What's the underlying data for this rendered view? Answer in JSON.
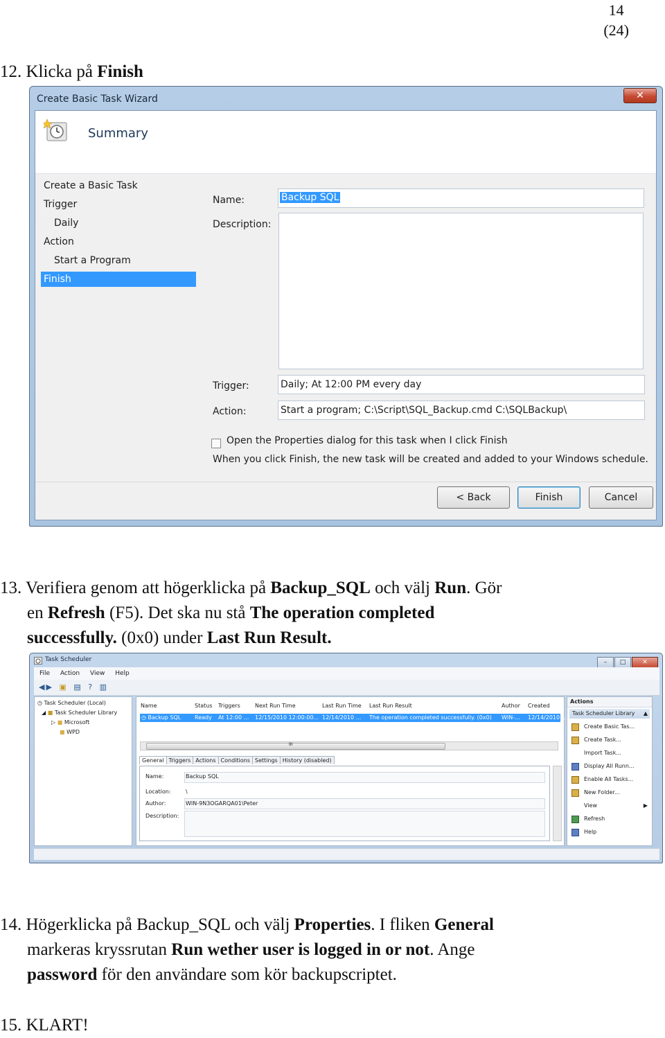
{
  "page": {
    "number": "14",
    "total": "(24)"
  },
  "step12": {
    "text": "12. Klicka på ",
    "bold": "Finish"
  },
  "wizard": {
    "title": "Create Basic Task Wizard",
    "close": "✕",
    "summary": "Summary",
    "nav": [
      "Create a Basic Task",
      "Trigger",
      "Daily",
      "Action",
      "Start a Program",
      "Finish"
    ],
    "name_label": "Name:",
    "name_value": "Backup SQL",
    "description_label": "Description:",
    "trigger_label": "Trigger:",
    "trigger_value": "Daily; At 12:00 PM every day",
    "action_label": "Action:",
    "action_value": "Start a program; C:\\Script\\SQL_Backup.cmd C:\\SQLBackup\\",
    "checkbox_label": "Open the Properties dialog for this task when I click Finish",
    "note": "When you click Finish, the new task will be created and added to your Windows schedule.",
    "back_button": "< Back",
    "finish_button": "Finish",
    "cancel_button": "Cancel"
  },
  "step13": {
    "t1": "13. Verifiera genom att högerklicka på ",
    "b1": "Backup_SQL",
    "t2": " och välj ",
    "b2": "Run",
    "t3": ". Gör",
    "t4": "en ",
    "b3": "Refresh",
    "t5": " (F5). Det ska nu stå ",
    "b4": "The operation completed",
    "b5": "successfully.",
    "t6": " (0x0) under ",
    "b6": "Last Run Result."
  },
  "scheduler": {
    "title": "Task Scheduler",
    "menu": [
      "File",
      "Action",
      "View",
      "Help"
    ],
    "tree": [
      "Task Scheduler (Local)",
      "Task Scheduler Library",
      "Microsoft",
      "WPD"
    ],
    "columns": [
      "Name",
      "Status",
      "Triggers",
      "Next Run Time",
      "Last Run Time",
      "Last Run Result",
      "Author",
      "Created"
    ],
    "row": [
      "Backup SQL",
      "Ready",
      "At 12:00 ...",
      "12/15/2010 12:00:00...",
      "12/14/2010 ...",
      "The operation completed successfully. (0x0)",
      "WIN-...",
      "12/14/2010 ..."
    ],
    "scroll_marker": "III",
    "tabs": [
      "General",
      "Triggers",
      "Actions",
      "Conditions",
      "Settings",
      "History (disabled)"
    ],
    "general": {
      "name_label": "Name:",
      "name_value": "Backup SQL",
      "location_label": "Location:",
      "location_value": "\\",
      "author_label": "Author:",
      "author_value": "WIN-9N3OGARQA01\\Peter",
      "description_label": "Description:"
    },
    "actions_header": "Actions",
    "actions_sub": "Task Scheduler Library",
    "actions": [
      "Create Basic Tas...",
      "Create Task...",
      "Import Task...",
      "Display All Runn...",
      "Enable All Tasks...",
      "New Folder...",
      "View",
      "Refresh",
      "Help"
    ]
  },
  "step14": {
    "t1": "14. Högerklicka på Backup_SQL och välj ",
    "b1": "Properties",
    "t2": ". I fliken ",
    "b2": "General",
    "t3": "markeras kryssrutan ",
    "b3": "Run wether user is logged in or not",
    "t4": ". Ange",
    "b4": "password",
    "t5": " för den användare som kör backupscriptet."
  },
  "step15": {
    "text": "15. KLART!"
  }
}
